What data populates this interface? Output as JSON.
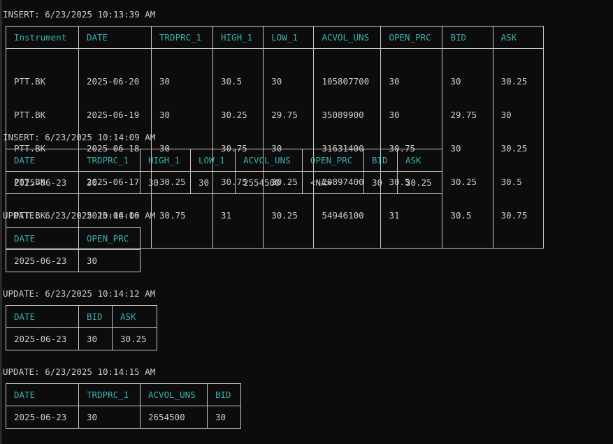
{
  "sections": [
    {
      "heading": "INSERT: 6/23/2025 10:13:39 AM",
      "columns": [
        "Instrument",
        "DATE",
        "TRDPRC_1",
        "HIGH_1",
        "LOW_1",
        "ACVOL_UNS",
        "OPEN_PRC",
        "BID",
        "ASK"
      ],
      "rows": [
        [
          "PTT.BK",
          "2025-06-20",
          "30",
          "30.5",
          "30",
          "105807700",
          "30",
          "30",
          "30.25"
        ],
        [
          "PTT.BK",
          "2025-06-19",
          "30",
          "30.25",
          "29.75",
          "35089900",
          "30",
          "29.75",
          "30"
        ],
        [
          "PTT.BK",
          "2025-06-18",
          "30",
          "30.75",
          "30",
          "31631400",
          "30.75",
          "30",
          "30.25"
        ],
        [
          "PTT.BK",
          "2025-06-17",
          "30.25",
          "30.75",
          "30.25",
          "20897400",
          "30.5",
          "30.25",
          "30.5"
        ],
        [
          "PTT.BK",
          "2025-06-16",
          "30.75",
          "31",
          "30.25",
          "54946100",
          "31",
          "30.5",
          "30.75"
        ]
      ]
    },
    {
      "heading": "INSERT: 6/23/2025 10:14:09 AM",
      "columns": [
        "DATE",
        "TRDPRC_1",
        "HIGH_1",
        "LOW_1",
        "ACVOL_UNS",
        "OPEN_PRC",
        "BID",
        "ASK"
      ],
      "rows": [
        [
          "2025-06-23",
          "30",
          "30",
          "30",
          "2554500",
          "<NA>",
          "30",
          "30.25"
        ]
      ]
    },
    {
      "heading": "UPDATE: 6/23/2025 10:14:09 AM",
      "columns": [
        "DATE",
        "OPEN_PRC"
      ],
      "rows": [
        [
          "2025-06-23",
          "30"
        ]
      ]
    },
    {
      "heading": "UPDATE: 6/23/2025 10:14:12 AM",
      "columns": [
        "DATE",
        "BID",
        "ASK"
      ],
      "rows": [
        [
          "2025-06-23",
          "30",
          "30.25"
        ]
      ]
    },
    {
      "heading": "UPDATE: 6/23/2025 10:14:15 AM",
      "columns": [
        "DATE",
        "TRDPRC_1",
        "ACVOL_UNS",
        "BID"
      ],
      "rows": [
        [
          "2025-06-23",
          "30",
          "2654500",
          "30"
        ]
      ]
    }
  ]
}
